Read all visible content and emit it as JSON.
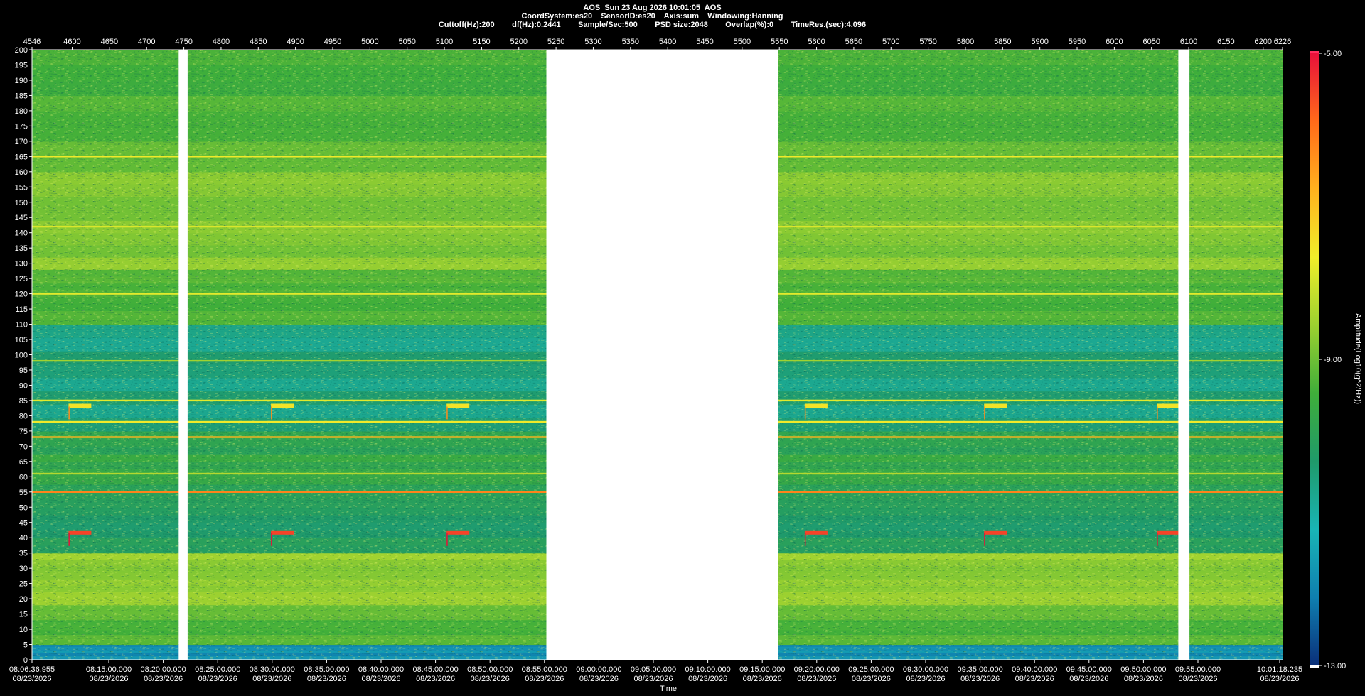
{
  "header": {
    "line1": "AOS  Sun 23 Aug 2026 10:01:05  AOS",
    "line2": "CoordSystem:es20    SensorID:es20    Axis:sum    Windowing:Hanning",
    "line3": "Cuttoff(Hz):200        df(Hz):0.2441        Sample/Sec:500        PSD size:2048        Overlap(%):0        TimeRes.(sec):4.096"
  },
  "colors": {
    "background": "#000000",
    "gap": "#ffffff",
    "text": "#ffffff"
  },
  "chart_data": {
    "type": "heatmap",
    "title": "",
    "xlabel": "Time",
    "ylabel": "",
    "colorbar_label": "Amplitude(Log10(g^2/Hz))",
    "colorbar_range": [
      -13.0,
      -5.0
    ],
    "colorbar_ticks": [
      "-5.00",
      "-9.00",
      "-13.00"
    ],
    "colorscale": [
      "#0a2f7a",
      "#0f7fb0",
      "#19b5b5",
      "#1f9a6a",
      "#3fae3a",
      "#9cd130",
      "#f0ee2a",
      "#ffb21e",
      "#ff6a1a",
      "#e8103a"
    ],
    "ylim": [
      0,
      200
    ],
    "y_ticks": [
      0,
      5,
      10,
      15,
      20,
      25,
      30,
      35,
      40,
      45,
      50,
      55,
      60,
      65,
      70,
      75,
      80,
      85,
      90,
      95,
      100,
      105,
      110,
      115,
      120,
      125,
      130,
      135,
      140,
      145,
      150,
      155,
      160,
      165,
      170,
      175,
      180,
      185,
      190,
      195,
      200
    ],
    "top_axis_range": [
      4546,
      6226
    ],
    "top_ticks": [
      4546,
      4600,
      4650,
      4700,
      4750,
      4800,
      4850,
      4900,
      4950,
      5000,
      5050,
      5100,
      5150,
      5200,
      5250,
      5300,
      5350,
      5400,
      5450,
      5500,
      5550,
      5600,
      5650,
      5700,
      5750,
      5800,
      5850,
      5900,
      5950,
      6000,
      6050,
      6100,
      6150,
      6200,
      6226
    ],
    "x_ticks": [
      {
        "time": "08:06:36.955",
        "date": "08/23/2026"
      },
      {
        "time": "08:15:00.000",
        "date": "08/23/2026"
      },
      {
        "time": "08:20:00.000",
        "date": "08/23/2026"
      },
      {
        "time": "08:25:00.000",
        "date": "08/23/2026"
      },
      {
        "time": "08:30:00.000",
        "date": "08/23/2026"
      },
      {
        "time": "08:35:00.000",
        "date": "08/23/2026"
      },
      {
        "time": "08:40:00.000",
        "date": "08/23/2026"
      },
      {
        "time": "08:45:00.000",
        "date": "08/23/2026"
      },
      {
        "time": "08:50:00.000",
        "date": "08/23/2026"
      },
      {
        "time": "08:55:00.000",
        "date": "08/23/2026"
      },
      {
        "time": "09:00:00.000",
        "date": "08/23/2026"
      },
      {
        "time": "09:05:00.000",
        "date": "08/23/2026"
      },
      {
        "time": "09:10:00.000",
        "date": "08/23/2026"
      },
      {
        "time": "09:15:00.000",
        "date": "08/23/2026"
      },
      {
        "time": "09:20:00.000",
        "date": "08/23/2026"
      },
      {
        "time": "09:25:00.000",
        "date": "08/23/2026"
      },
      {
        "time": "09:30:00.000",
        "date": "08/23/2026"
      },
      {
        "time": "09:35:00.000",
        "date": "08/23/2026"
      },
      {
        "time": "09:40:00.000",
        "date": "08/23/2026"
      },
      {
        "time": "09:45:00.000",
        "date": "08/23/2026"
      },
      {
        "time": "09:50:00.000",
        "date": "08/23/2026"
      },
      {
        "time": "09:55:00.000",
        "date": "08/23/2026"
      },
      {
        "time": "10:01:18.235",
        "date": "08/23/2026"
      }
    ],
    "data_gaps": [
      {
        "from": 4743,
        "to": 4755
      },
      {
        "from": 5237,
        "to": 5548
      },
      {
        "from": 6086,
        "to": 6101
      }
    ],
    "level_bands": [
      {
        "fmin": 0,
        "fmax": 5,
        "level": -11.8
      },
      {
        "fmin": 5,
        "fmax": 18,
        "level": -9.2
      },
      {
        "fmin": 18,
        "fmax": 35,
        "level": -8.6
      },
      {
        "fmin": 35,
        "fmax": 55,
        "level": -10.3
      },
      {
        "fmin": 55,
        "fmax": 75,
        "level": -9.8
      },
      {
        "fmin": 75,
        "fmax": 110,
        "level": -10.6
      },
      {
        "fmin": 110,
        "fmax": 128,
        "level": -9.4
      },
      {
        "fmin": 128,
        "fmax": 160,
        "level": -8.8
      },
      {
        "fmin": 160,
        "fmax": 200,
        "level": -9.3
      }
    ],
    "tonal_lines": [
      {
        "freq": 55,
        "level": -6.2
      },
      {
        "freq": 73,
        "level": -6.8
      },
      {
        "freq": 78,
        "level": -7.6
      },
      {
        "freq": 85,
        "level": -7.8
      },
      {
        "freq": 120,
        "level": -7.8
      },
      {
        "freq": 142,
        "level": -7.9
      },
      {
        "freq": 165,
        "level": -7.6
      },
      {
        "freq": 61,
        "level": -8.3
      },
      {
        "freq": 98,
        "level": -8.5
      }
    ],
    "events": [
      {
        "x": 4596,
        "freq": 41.5,
        "level": -5.5
      },
      {
        "x": 4596,
        "freq": 83,
        "level": -7.5
      },
      {
        "x": 4868,
        "freq": 41.5,
        "level": -5.5
      },
      {
        "x": 4868,
        "freq": 83,
        "level": -7.5
      },
      {
        "x": 5104,
        "freq": 41.5,
        "level": -5.5
      },
      {
        "x": 5104,
        "freq": 83,
        "level": -7.5
      },
      {
        "x": 5585,
        "freq": 41.5,
        "level": -5.5
      },
      {
        "x": 5585,
        "freq": 83,
        "level": -7.5
      },
      {
        "x": 5826,
        "freq": 41.5,
        "level": -5.5
      },
      {
        "x": 5826,
        "freq": 83,
        "level": -7.5
      },
      {
        "x": 6058,
        "freq": 41.5,
        "level": -5.5
      },
      {
        "x": 6058,
        "freq": 83,
        "level": -7.5
      }
    ],
    "grid": false,
    "legend": "colorbar-right"
  }
}
